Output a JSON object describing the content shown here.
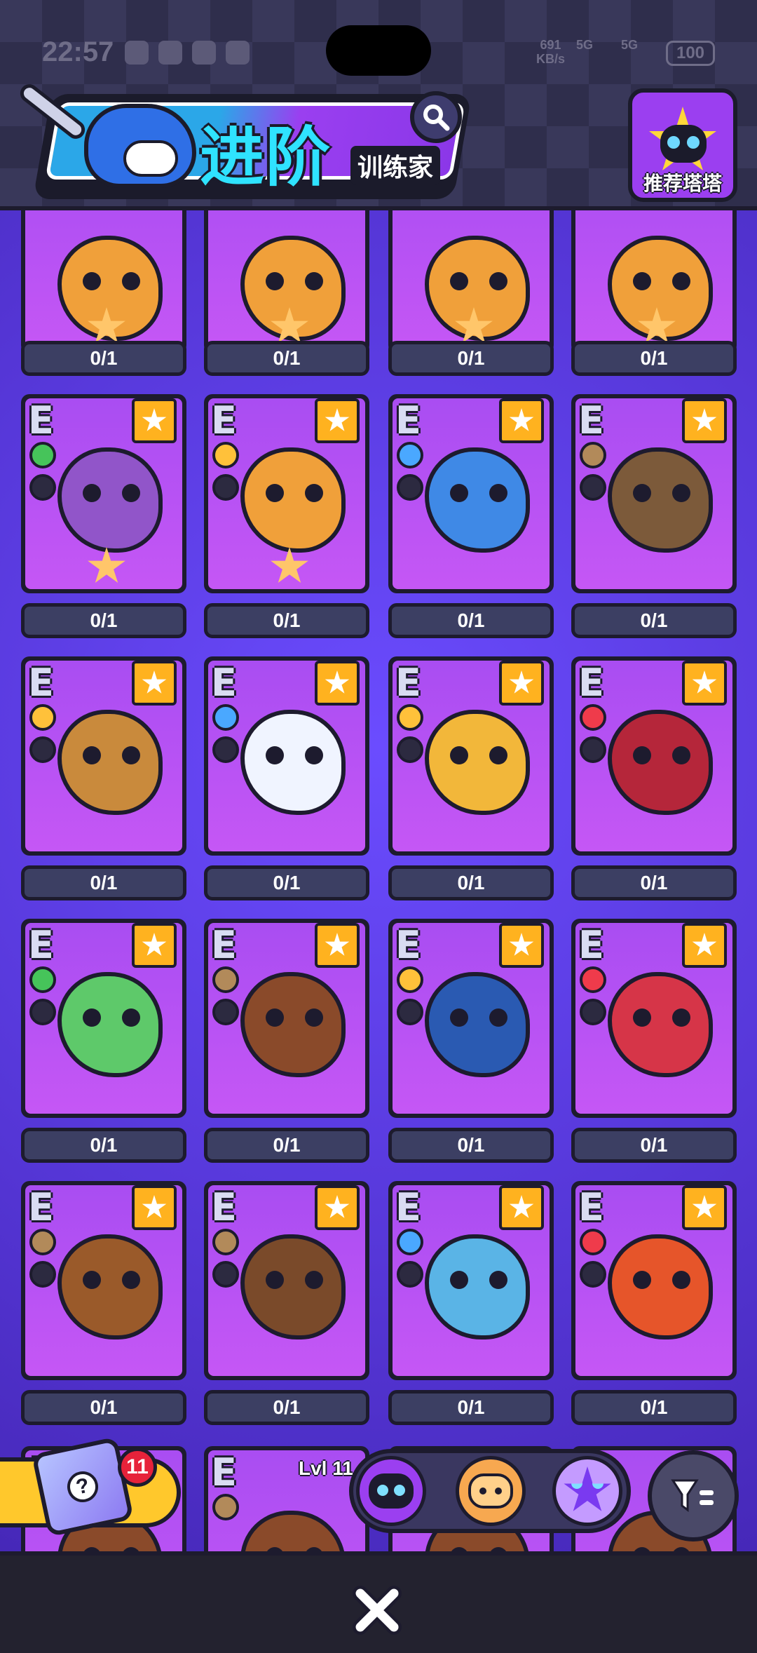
{
  "status_bar": {
    "time": "22:57",
    "net_speed": "691",
    "net_unit": "KB/s",
    "sig1": "5G",
    "sig2": "5G",
    "battery": "100"
  },
  "header": {
    "title": "进阶",
    "subtitle": "训练家",
    "recommend_label": "推荐塔塔"
  },
  "grid": {
    "columns": 4,
    "rank_letter": "E",
    "top_row_counts": [
      "0/1",
      "0/1",
      "0/1",
      "0/1"
    ],
    "rows": [
      [
        {
          "color": "#9155c9",
          "el1": "#46c45a",
          "count": "0/1"
        },
        {
          "color": "#f0a03a",
          "el1": "#ffc13a",
          "count": "0/1"
        },
        {
          "color": "#3f89e6",
          "el1": "#4aa8ff",
          "count": "0/1"
        },
        {
          "color": "#7c5a3a",
          "el1": "#b28a5a",
          "count": "0/1"
        }
      ],
      [
        {
          "color": "#c98a3c",
          "el1": "#ffc13a",
          "count": "0/1"
        },
        {
          "color": "#f0f4ff",
          "el1": "#4aa8ff",
          "count": "0/1"
        },
        {
          "color": "#f2b73a",
          "el1": "#ffc13a",
          "count": "0/1"
        },
        {
          "color": "#b5263a",
          "el1": "#ef3b4b",
          "count": "0/1"
        }
      ],
      [
        {
          "color": "#5ec96a",
          "el1": "#46c45a",
          "count": "0/1"
        },
        {
          "color": "#8a4a2a",
          "el1": "#b28a5a",
          "count": "0/1"
        },
        {
          "color": "#2a5ab2",
          "el1": "#ffc13a",
          "count": "0/1"
        },
        {
          "color": "#d63548",
          "el1": "#ef3b4b",
          "count": "0/1"
        }
      ],
      [
        {
          "color": "#9a5a2a",
          "el1": "#b28a5a",
          "count": "0/1"
        },
        {
          "color": "#7a4a2a",
          "el1": "#b28a5a",
          "count": "0/1"
        },
        {
          "color": "#5ab4e6",
          "el1": "#4aa8ff",
          "count": "0/1"
        },
        {
          "color": "#e6552a",
          "el1": "#ef3b4b",
          "count": "0/1"
        }
      ]
    ]
  },
  "bottom": {
    "mystery_box_badge": "11",
    "box_symbol": "?",
    "level_text": "Lvl 11"
  },
  "icons": {
    "search": "search-icon",
    "filter": "filter-icon",
    "close": "close-icon"
  },
  "colors": {
    "accent_purple": "#9b3ff0",
    "title_cyan": "#2fe3ff",
    "star_gold": "#ffb21f",
    "background": "#5b3fd6"
  }
}
